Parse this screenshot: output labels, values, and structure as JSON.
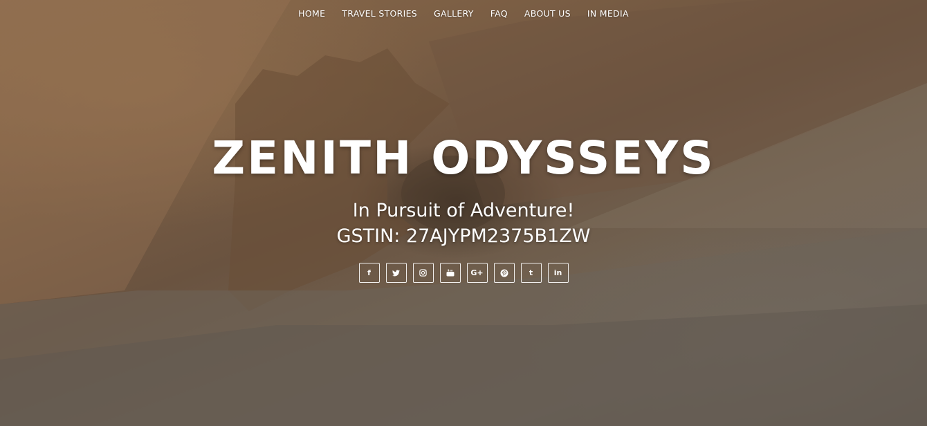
{
  "nav": {
    "items": [
      {
        "label": "HOME"
      },
      {
        "label": "TRAVEL STORIES"
      },
      {
        "label": "GALLERY"
      },
      {
        "label": "FAQ"
      },
      {
        "label": "ABOUT US"
      },
      {
        "label": "IN MEDIA"
      }
    ]
  },
  "hero": {
    "title": "ZENITH ODYSSEYS",
    "tagline": "In Pursuit of Adventure!",
    "gstin": "GSTIN: 27AJYPM2375B1ZW"
  },
  "social": {
    "icons": [
      {
        "icon": "facebook-icon",
        "glyph": "f"
      },
      {
        "icon": "twitter-icon",
        "glyph": ""
      },
      {
        "icon": "instagram-icon",
        "glyph": ""
      },
      {
        "icon": "youtube-icon",
        "glyph": ""
      },
      {
        "icon": "google-plus-icon",
        "glyph": "G+"
      },
      {
        "icon": "pinterest-icon",
        "glyph": ""
      },
      {
        "icon": "tumblr-icon",
        "glyph": "t"
      },
      {
        "icon": "linkedin-icon",
        "glyph": "in"
      }
    ]
  },
  "colors": {
    "text": "#ffffff",
    "background_tone": "#7b5e44"
  }
}
